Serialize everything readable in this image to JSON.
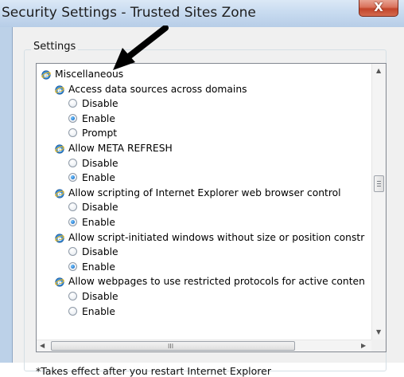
{
  "window": {
    "title": "Security Settings - Trusted Sites Zone",
    "close_glyph": "X"
  },
  "settings": {
    "group_label": "Settings",
    "footnote": "*Takes effect after you restart Internet Explorer"
  },
  "tree": {
    "category": "Miscellaneous",
    "items": [
      {
        "label": "Access data sources across domains",
        "options": [
          {
            "label": "Disable",
            "selected": false
          },
          {
            "label": "Enable",
            "selected": true
          },
          {
            "label": "Prompt",
            "selected": false
          }
        ]
      },
      {
        "label": "Allow META REFRESH",
        "options": [
          {
            "label": "Disable",
            "selected": false
          },
          {
            "label": "Enable",
            "selected": true
          }
        ]
      },
      {
        "label": "Allow scripting of Internet Explorer web browser control",
        "options": [
          {
            "label": "Disable",
            "selected": false
          },
          {
            "label": "Enable",
            "selected": true
          }
        ]
      },
      {
        "label": "Allow script-initiated windows without size or position constr",
        "options": [
          {
            "label": "Disable",
            "selected": false
          },
          {
            "label": "Enable",
            "selected": true
          }
        ]
      },
      {
        "label": "Allow webpages to use restricted protocols for active conten",
        "options": [
          {
            "label": "Disable",
            "selected": false
          },
          {
            "label": "Enable",
            "selected": false
          }
        ]
      }
    ]
  },
  "scrollbars": {
    "hscroll_grip": "III",
    "up_glyph": "▲",
    "down_glyph": "▼",
    "left_glyph": "◀",
    "right_glyph": "▶"
  },
  "icons": {
    "setting_icon": "ie-e-icon",
    "annotation": "black-arrow-icon"
  },
  "colors": {
    "radio_selected": "#2178d0",
    "titlebar": "#c8dbf0",
    "close_button": "#c2442a"
  }
}
